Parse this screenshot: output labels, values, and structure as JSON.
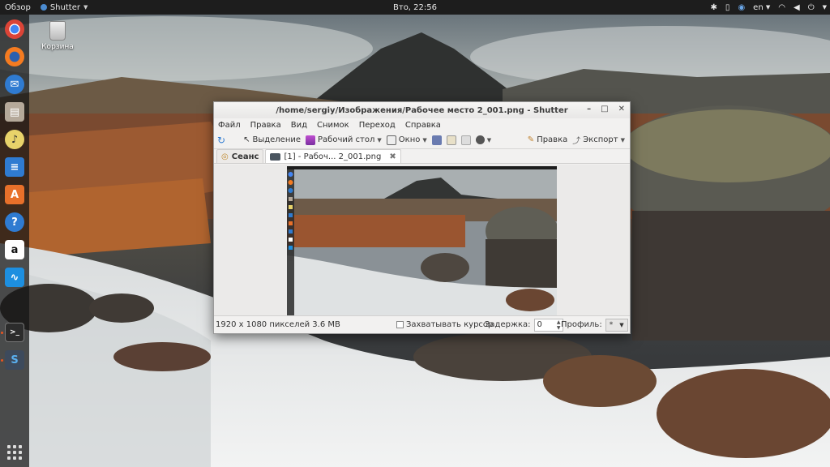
{
  "topbar": {
    "activities": "Обзор",
    "app_name": "Shutter",
    "clock": "Вто, 22:56",
    "language": "en"
  },
  "desktop": {
    "trash_label": "Корзина"
  },
  "window": {
    "title": "/home/sergiy/Изображения/Рабочее место 2_001.png - Shutter",
    "menu": [
      "Файл",
      "Правка",
      "Вид",
      "Снимок",
      "Переход",
      "Справка"
    ],
    "toolbar": {
      "selection": "Выделение",
      "desktop": "Рабочий стол",
      "window": "Окно",
      "edit": "Правка",
      "export": "Экспорт"
    },
    "tabs": {
      "session": "Сеанс",
      "file": "[1] - Рабоч... 2_001.png"
    },
    "status": {
      "info": "1920 x 1080 пикселей  3.6 MB",
      "capture_cursor": "Захватывать курсор",
      "delay_label": "Задержка:",
      "delay_value": "0",
      "profile_label": "Профиль:",
      "profile_value": "*"
    }
  },
  "colors": {
    "topbar": "#1d1d1d",
    "accent": "#e95420"
  }
}
